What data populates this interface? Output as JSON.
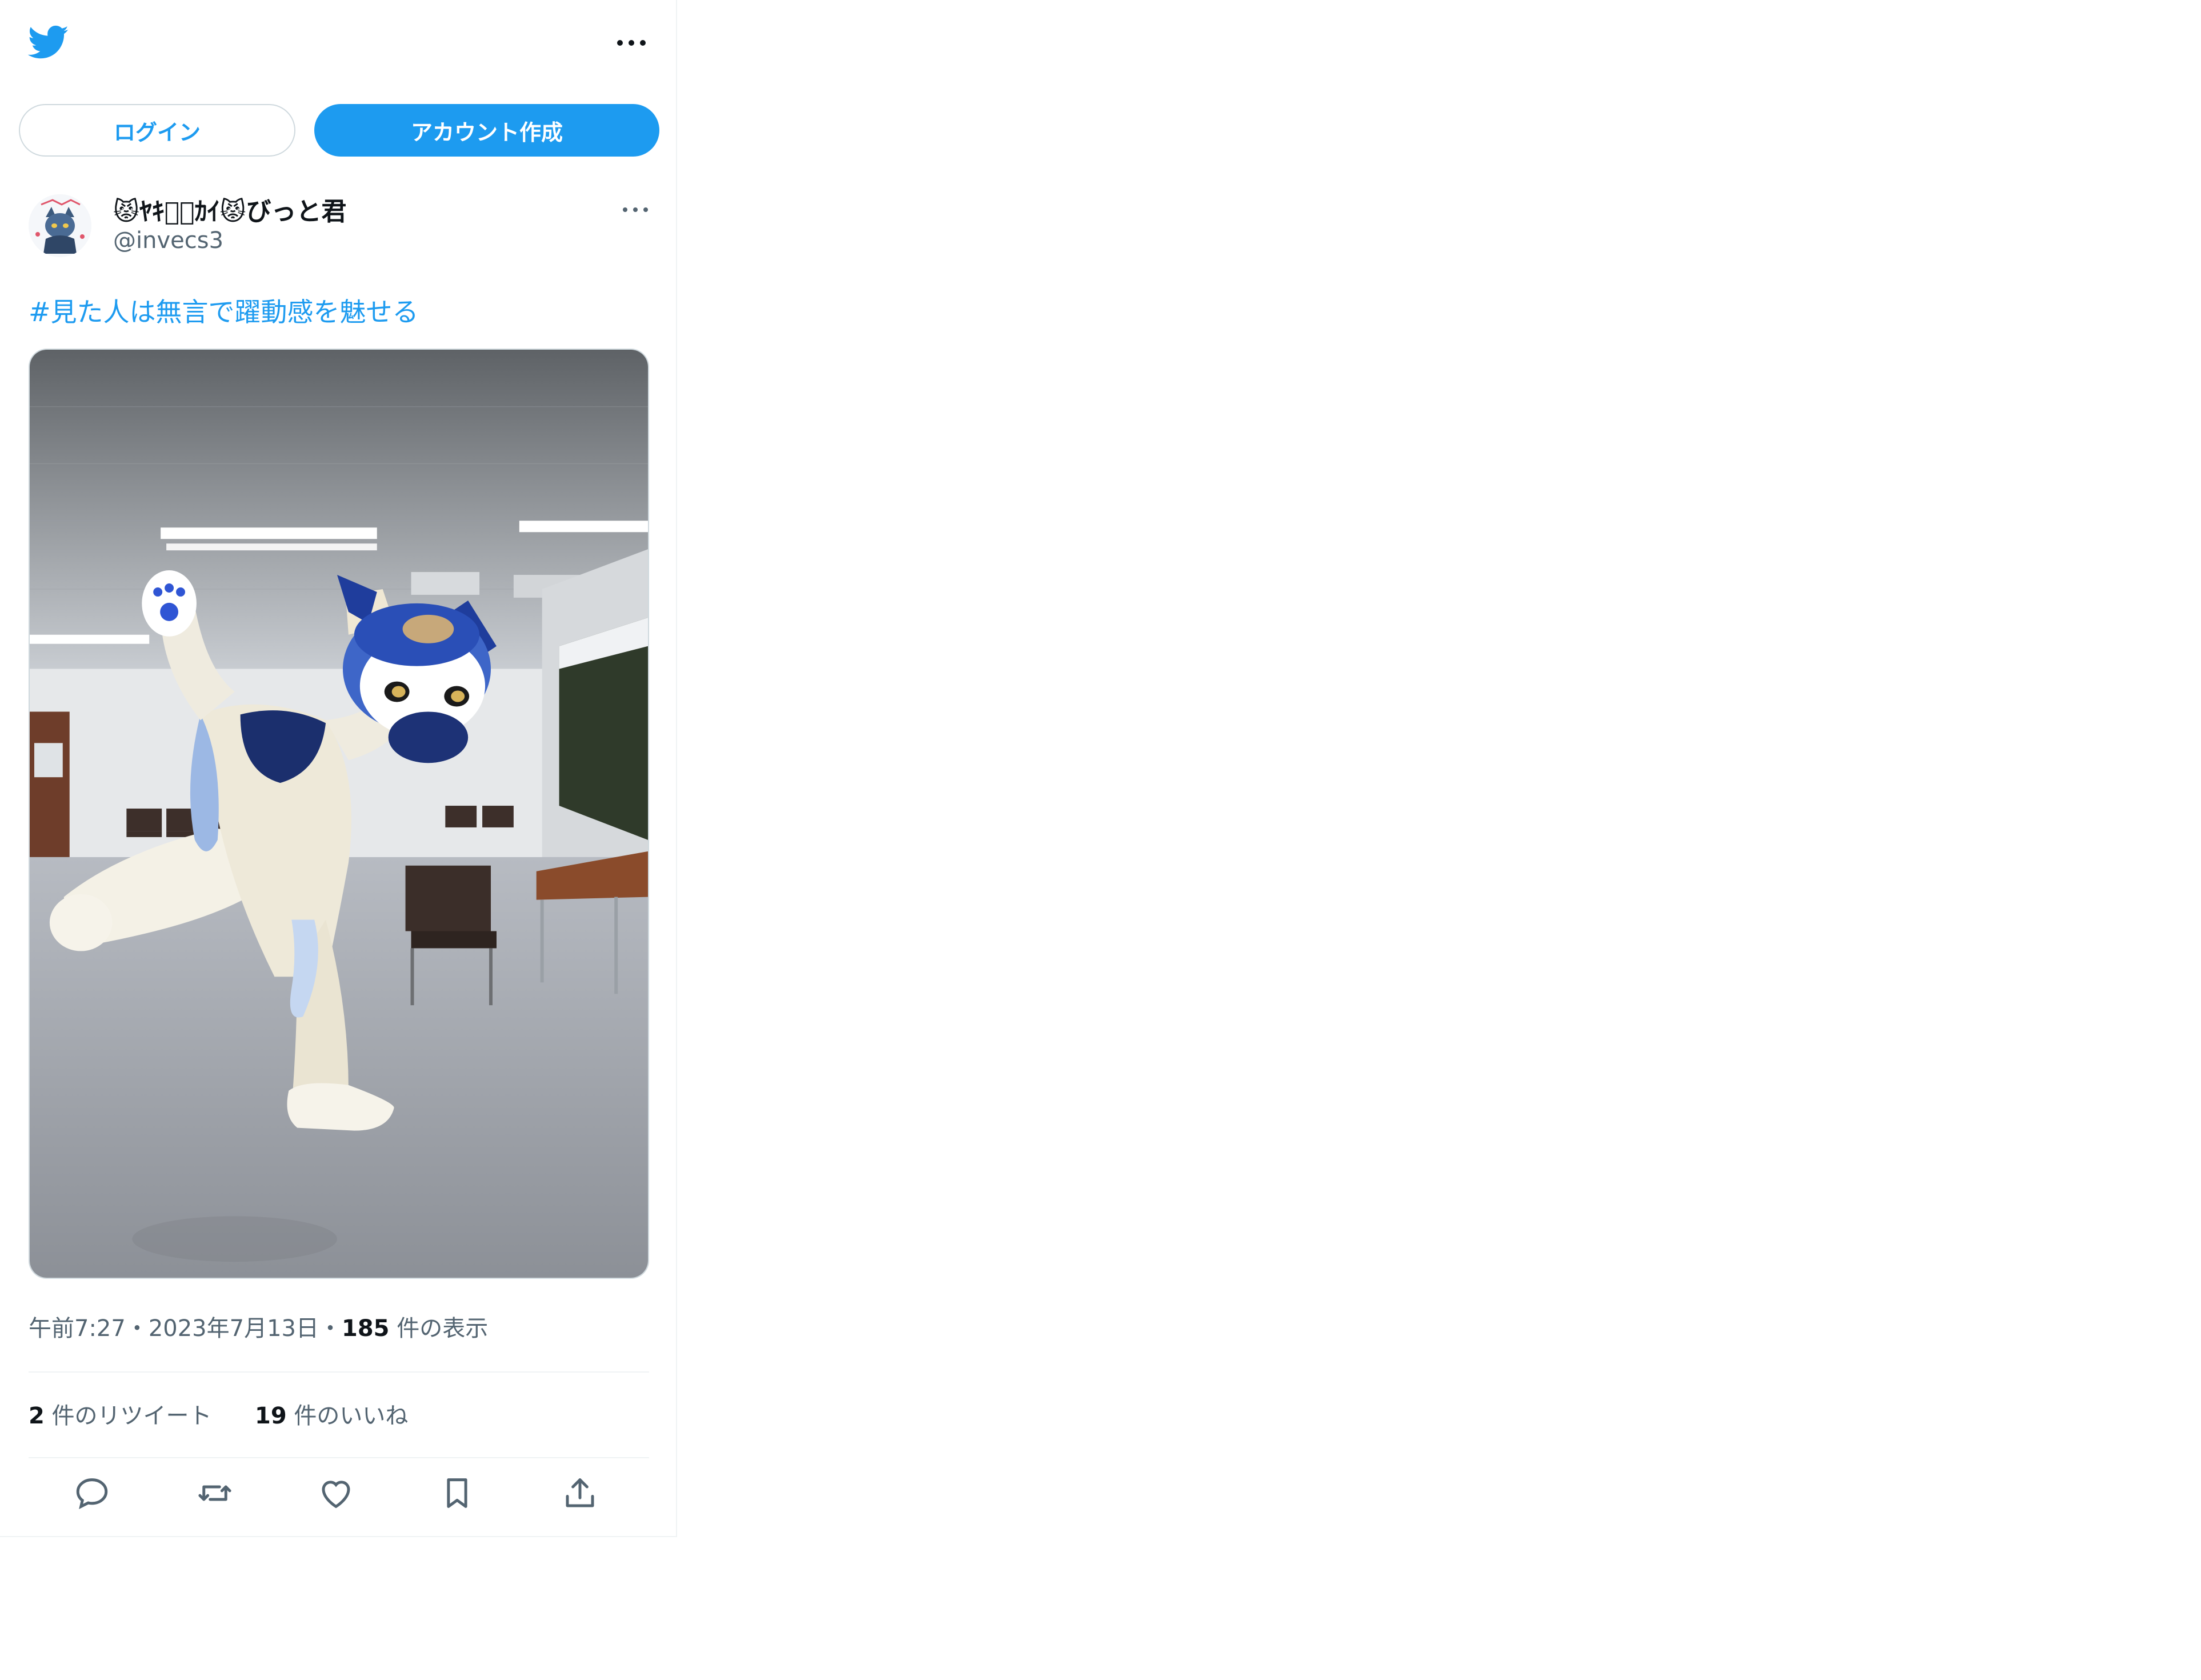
{
  "header": {
    "logo_icon": "twitter-bird-icon",
    "more_icon": "more-horizontal-icon"
  },
  "auth": {
    "login_label": "ログイン",
    "signup_label": "アカウント作成"
  },
  "tweet": {
    "display_name": "😾ﾔｷ⍰ﾞｶｲ😾びっと君",
    "handle": "@invecs3",
    "hashtag": "#見た人は無言で躍動感を魅せる",
    "time": "午前7:27",
    "separator": "・",
    "date": "2023年7月13日",
    "separator2": "・",
    "views_count": "185",
    "views_label": " 件の表示",
    "retweets_count": "2",
    "retweets_label": " 件のリツイート",
    "likes_count": "19",
    "likes_label": " 件のいいね"
  },
  "actions": [
    "reply-icon",
    "retweet-icon",
    "like-icon",
    "bookmark-icon",
    "share-icon"
  ],
  "colors": {
    "accent": "#1d9bf0",
    "text_primary": "#0f1419",
    "text_secondary": "#536471",
    "divider": "#eff3f4"
  }
}
